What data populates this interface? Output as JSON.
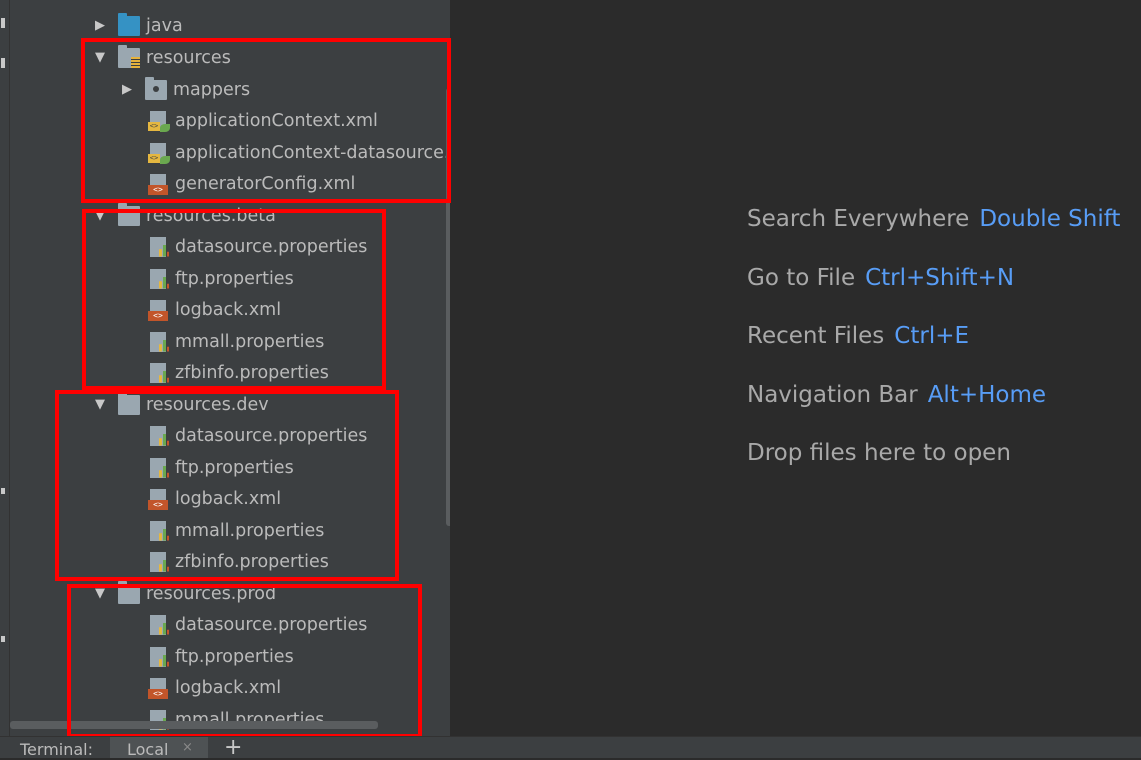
{
  "project_tree": [
    {
      "kind": "folder",
      "icon": "folder-blue",
      "arrow": "right",
      "label": "java",
      "indent": 1
    },
    {
      "kind": "folder",
      "icon": "folder-resources",
      "arrow": "down",
      "label": "resources",
      "indent": 1
    },
    {
      "kind": "folder",
      "icon": "folder-dot",
      "arrow": "right",
      "label": "mappers",
      "indent": 2
    },
    {
      "kind": "file",
      "icon": "spring-xml",
      "label": "applicationContext.xml",
      "indent": 2
    },
    {
      "kind": "file",
      "icon": "spring-xml",
      "label": "applicationContext-datasource.",
      "indent": 2
    },
    {
      "kind": "file",
      "icon": "xml",
      "label": "generatorConfig.xml",
      "indent": 2
    },
    {
      "kind": "folder",
      "icon": "folder-grey",
      "arrow": "down",
      "label": "resources.beta",
      "indent": 1
    },
    {
      "kind": "file",
      "icon": "properties",
      "label": "datasource.properties",
      "indent": 2
    },
    {
      "kind": "file",
      "icon": "properties",
      "label": "ftp.properties",
      "indent": 2
    },
    {
      "kind": "file",
      "icon": "xml",
      "label": "logback.xml",
      "indent": 2
    },
    {
      "kind": "file",
      "icon": "properties",
      "label": "mmall.properties",
      "indent": 2
    },
    {
      "kind": "file",
      "icon": "properties",
      "label": "zfbinfo.properties",
      "indent": 2
    },
    {
      "kind": "folder",
      "icon": "folder-grey",
      "arrow": "down",
      "label": "resources.dev",
      "indent": 1
    },
    {
      "kind": "file",
      "icon": "properties",
      "label": "datasource.properties",
      "indent": 2
    },
    {
      "kind": "file",
      "icon": "properties",
      "label": "ftp.properties",
      "indent": 2
    },
    {
      "kind": "file",
      "icon": "xml",
      "label": "logback.xml",
      "indent": 2
    },
    {
      "kind": "file",
      "icon": "properties",
      "label": "mmall.properties",
      "indent": 2
    },
    {
      "kind": "file",
      "icon": "properties",
      "label": "zfbinfo.properties",
      "indent": 2
    },
    {
      "kind": "folder",
      "icon": "folder-grey",
      "arrow": "down",
      "label": "resources.prod",
      "indent": 1
    },
    {
      "kind": "file",
      "icon": "properties",
      "label": "datasource.properties",
      "indent": 2
    },
    {
      "kind": "file",
      "icon": "properties",
      "label": "ftp.properties",
      "indent": 2
    },
    {
      "kind": "file",
      "icon": "xml",
      "label": "logback.xml",
      "indent": 2
    },
    {
      "kind": "file",
      "icon": "properties",
      "label": "mmall.properties",
      "indent": 2
    }
  ],
  "editor_hints": [
    {
      "text": "Search Everywhere",
      "shortcut": "Double Shift"
    },
    {
      "text": "Go to File",
      "shortcut": "Ctrl+Shift+N"
    },
    {
      "text": "Recent Files",
      "shortcut": "Ctrl+E"
    },
    {
      "text": "Navigation Bar",
      "shortcut": "Alt+Home"
    },
    {
      "text": "Drop files here to open",
      "shortcut": ""
    }
  ],
  "terminal": {
    "label": "Terminal:",
    "tab": "Local",
    "close_glyph": "×",
    "add_glyph": "+"
  },
  "colors": {
    "panel_bg": "#3c3f41",
    "editor_bg": "#2b2b2b",
    "shortcut": "#589df6",
    "highlight_box": "#ff0000"
  }
}
